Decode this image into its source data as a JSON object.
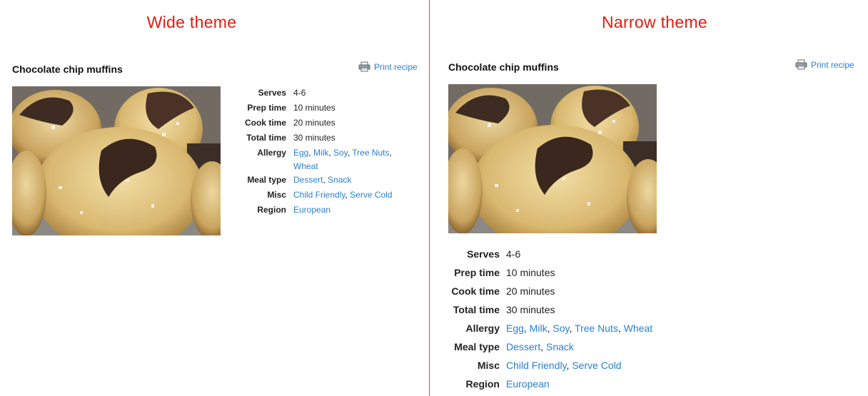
{
  "wide": {
    "heading": "Wide theme",
    "recipe_title": "Chocolate chip muffins",
    "print_label": "Print recipe",
    "facts": {
      "serves": {
        "label": "Serves",
        "value": "4-6"
      },
      "prep": {
        "label": "Prep time",
        "value": "10 minutes"
      },
      "cook": {
        "label": "Cook time",
        "value": "20 minutes"
      },
      "total": {
        "label": "Total time",
        "value": "30 minutes"
      },
      "allergy": {
        "label": "Allergy",
        "links": [
          "Egg",
          "Milk",
          "Soy",
          "Tree Nuts",
          "Wheat"
        ]
      },
      "meal": {
        "label": "Meal type",
        "links": [
          "Dessert",
          "Snack"
        ]
      },
      "misc": {
        "label": "Misc",
        "links": [
          "Child Friendly",
          "Serve Cold"
        ]
      },
      "region": {
        "label": "Region",
        "links": [
          "European"
        ]
      }
    }
  },
  "narrow": {
    "heading": "Narrow theme",
    "recipe_title": "Chocolate chip muffins",
    "print_label": "Print recipe",
    "facts": {
      "serves": {
        "label": "Serves",
        "value": "4-6"
      },
      "prep": {
        "label": "Prep time",
        "value": "10 minutes"
      },
      "cook": {
        "label": "Cook time",
        "value": "20 minutes"
      },
      "total": {
        "label": "Total time",
        "value": "30 minutes"
      },
      "allergy": {
        "label": "Allergy",
        "links": [
          "Egg",
          "Milk",
          "Soy",
          "Tree Nuts",
          "Wheat"
        ]
      },
      "meal": {
        "label": "Meal type",
        "links": [
          "Dessert",
          "Snack"
        ]
      },
      "misc": {
        "label": "Misc",
        "links": [
          "Child Friendly",
          "Serve Cold"
        ]
      },
      "region": {
        "label": "Region",
        "links": [
          "European"
        ]
      }
    }
  },
  "colors": {
    "heading": "#e8190f",
    "link": "#2a7fd0",
    "divider": "#d94a4a"
  },
  "icons": {
    "print": "printer-icon"
  }
}
